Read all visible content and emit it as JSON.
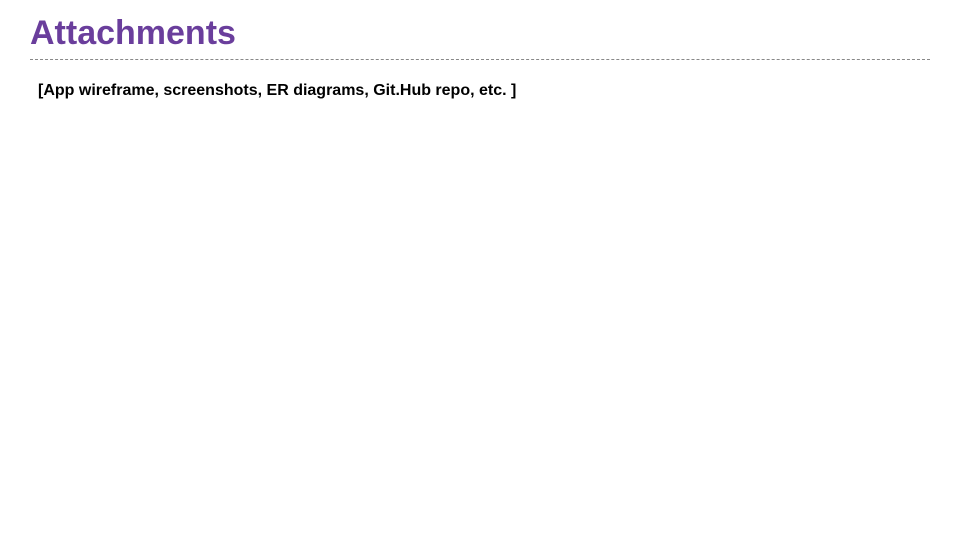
{
  "heading": "Attachments",
  "body": "[App wireframe, screenshots, ER diagrams, Git.Hub repo, etc. ]"
}
